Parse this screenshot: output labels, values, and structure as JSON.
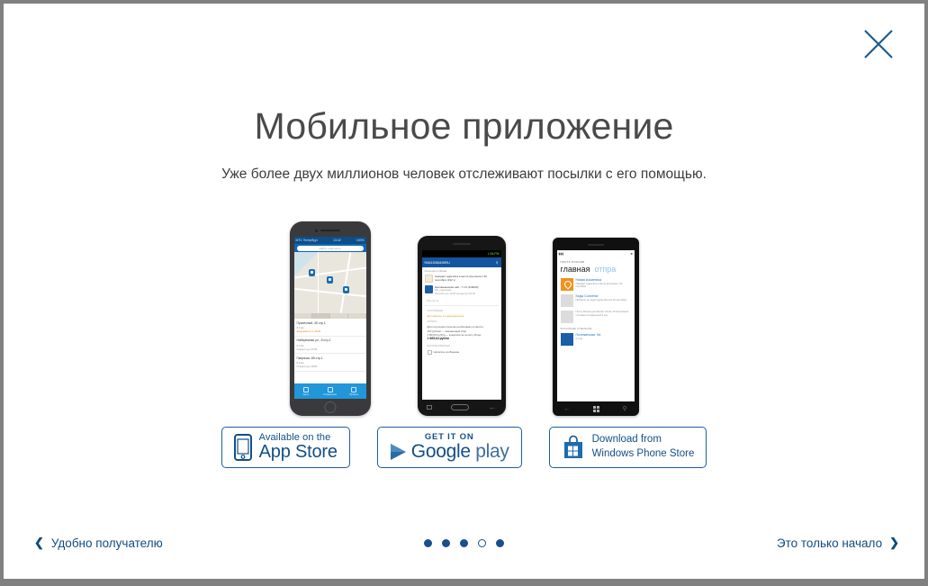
{
  "modal": {
    "close_label": "×",
    "title": "Мобильное приложение",
    "subtitle": "Уже более двух миллионов человек отслеживают посылки с его помощью."
  },
  "accent_color": "#134f87",
  "badges": [
    {
      "id": "app-store",
      "icon": "iphone-icon",
      "line1": "Available on the",
      "line2": "App Store"
    },
    {
      "id": "google-play",
      "icon": "play-triangle-icon",
      "line1": "GET IT ON",
      "line2": "Google",
      "line2b": " play"
    },
    {
      "id": "windows-phone-store",
      "icon": "windows-bag-icon",
      "line1": "Download from",
      "line2": "Windows Phone Store"
    }
  ],
  "footer": {
    "prev_chevron": "❮",
    "prev_label": "Удобно получателю",
    "next_label": "Это только начало",
    "next_chevron": "❯",
    "dots": [
      {
        "active": false
      },
      {
        "active": false
      },
      {
        "active": false
      },
      {
        "active": true
      },
      {
        "active": false
      }
    ]
  },
  "phones": {
    "iphone": {
      "status_left": "МТС Петербург",
      "status_center": "13:42",
      "status_right": "100%",
      "search_placeholder": "Найти отделение",
      "segments": [
        "Все",
        "Почтоматы",
        "Отделения",
        "Ящики"
      ],
      "rows": [
        {
          "title": "Прачечный, 4б стр.1",
          "sub": "0.1 км",
          "note": "Закрывается в 18:00"
        },
        {
          "title": "Набережная ул., 8 стр.2",
          "sub": "0.3 км",
          "note": "Открыто до 17:00"
        },
        {
          "title": "Гаврская, 4В стр.1",
          "sub": "0.6 км",
          "note": "Открыто до 19:00"
        }
      ],
      "tabs": [
        "Карта",
        "Отправления",
        "Профиль"
      ]
    },
    "android": {
      "status_time": "1:56 PM",
      "appbar_title": "RA613066435RU",
      "appbar_icon": "search-icon",
      "section": "Посылка от Браta",
      "rows": [
        {
          "icon": "envelope-icon",
          "title": "Ожидает адресата в месте вручения с 20 сентября (132 ч)",
          "sub": ""
        },
        {
          "icon": "parcel-icon",
          "title": "Наставненская наб., 7 к.5 (119000)",
          "sub": "641 отделение",
          "sub2": "Получить до 14:05 сегодня до 20:00"
        }
      ],
      "link_more": "Вся почта",
      "label_status": "СОСТОЯНИЕ",
      "warning": "Доставлено в подразделение",
      "label_payment": "ОПЛАТА",
      "pay_intro": "Для получения посылки необходимо оплатить:",
      "pay_line1": "150 рублей — таможенный сбор",
      "pay_line2": "1 664,64 рубля — комиссия за оплату сбора",
      "pay_total": "1 665,64 рубля",
      "label_extra": "ДОПОЛНИТЕЛЬНО",
      "checkbox_label": "Написать сообщение"
    },
    "winphone": {
      "brand": "ПОЧТА РОССИИ",
      "pivot_active": "главная",
      "pivot_next": "отпра",
      "rows": [
        {
          "tile": "orange",
          "title": "Новая косметика",
          "sub": "Ожидает адресата в месте вручения с 20 сентября"
        },
        {
          "tile": "gray",
          "title": "Кеды Converse",
          "sub": "Прибыло на территорию России 25 сентября"
        },
        {
          "tile": "gray",
          "title": "",
          "sub": "Почта России доставляет более 15 миллионов почтовых отправлений в год"
        }
      ],
      "section": "БЛИЖАЙШЕЕ ОТДЕЛЕНИЕ",
      "office_title": "Почтамтская, 9А",
      "office_dist": "0.1 км",
      "office_sub": "190000"
    }
  }
}
